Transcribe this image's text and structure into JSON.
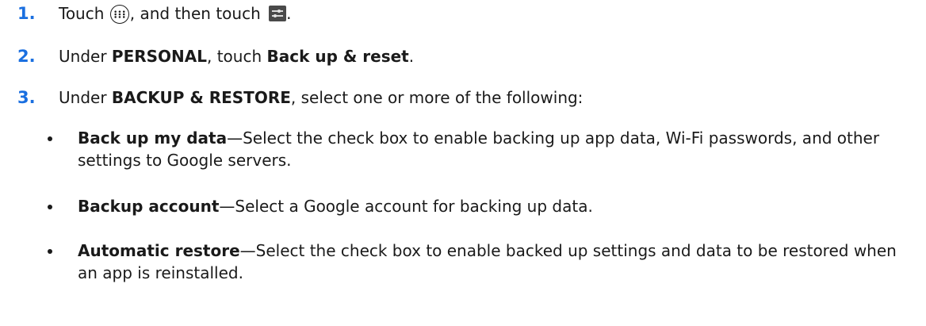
{
  "steps": [
    {
      "number": "1.",
      "part1": "Touch ",
      "part2": ", and then touch ",
      "part3": ".",
      "icon1": "apps-grid-icon",
      "icon2": "settings-icon"
    },
    {
      "number": "2.",
      "part1": "Under ",
      "bold1": "PERSONAL",
      "part2": ", touch ",
      "bold2": "Back up & reset",
      "part3": "."
    },
    {
      "number": "3.",
      "part1": "Under ",
      "bold1": "BACKUP & RESTORE",
      "part2": ", select one or more of the following:"
    }
  ],
  "options": [
    {
      "title": "Back up my data",
      "description": "—Select the check box to enable backing up app data, Wi-Fi passwords, and other settings to Google servers."
    },
    {
      "title": "Backup account",
      "description": "—Select a Google account for backing up data."
    },
    {
      "title": "Automatic restore",
      "description": "—Select the check box to enable backed up settings and data to be restored when an app is reinstalled."
    }
  ],
  "colors": {
    "step_number": "#1a6fe0",
    "text": "#1a1a1a"
  }
}
